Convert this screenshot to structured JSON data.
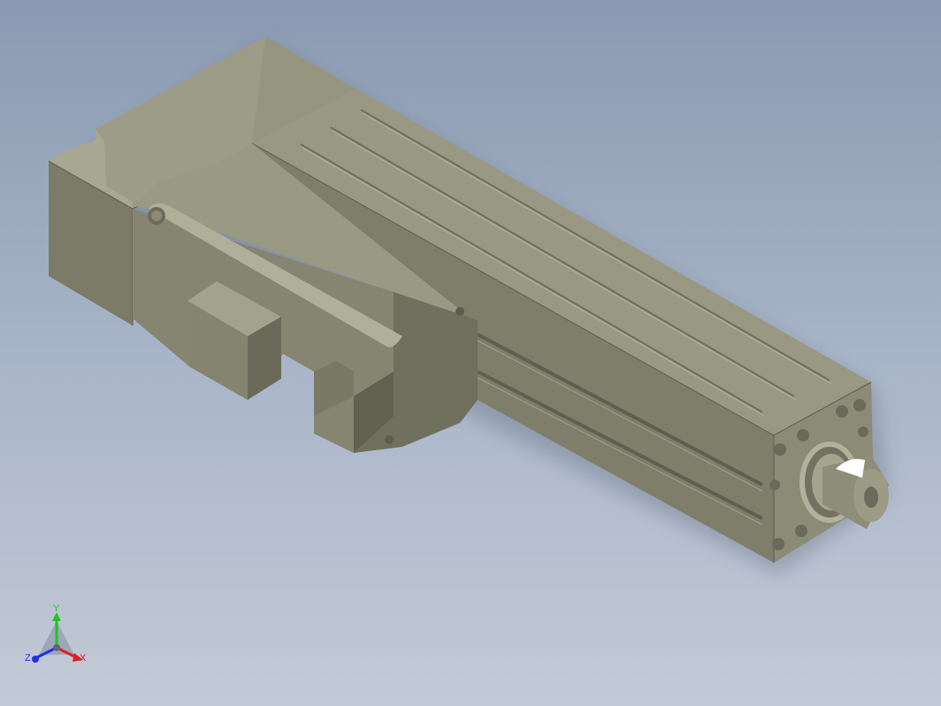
{
  "viewport": {
    "background_top": "#8b9ab2",
    "background_bottom": "#c3cad7"
  },
  "model": {
    "body_color": "#8f8e79",
    "shadow_color": "#6f6e5f",
    "highlight_color": "#a09f89"
  },
  "triad": {
    "y_label": "Y",
    "x_label": "X",
    "z_label": "Z",
    "y_color": "#22c522",
    "x_color": "#e02020",
    "z_color": "#2030e0"
  }
}
